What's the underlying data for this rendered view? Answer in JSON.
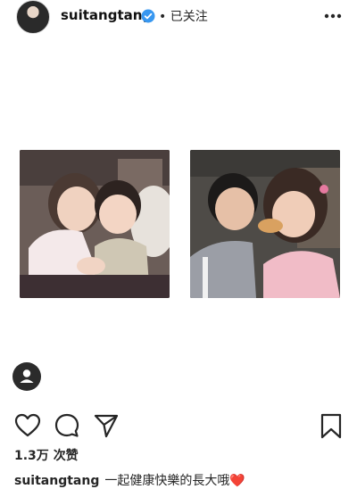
{
  "header": {
    "username": "suitangtang",
    "follow_status": "• 已关注",
    "more_icon": "more-dots-icon",
    "verified_icon": "verified-badge-icon"
  },
  "post": {
    "photos": [
      {
        "name": "left-photo"
      },
      {
        "name": "right-photo"
      }
    ],
    "tag_icon": "person-tag-icon"
  },
  "actions": {
    "like_icon": "heart-icon",
    "comment_icon": "comment-bubble-icon",
    "share_icon": "paper-plane-icon",
    "save_icon": "bookmark-icon"
  },
  "likes": {
    "count": "1.3万",
    "label": "次赞"
  },
  "caption": {
    "username": "suitangtang",
    "text": "一起健康快樂的長大哦",
    "emoji": "❤️"
  },
  "colors": {
    "verified_blue": "#3897f0",
    "text": "#262626",
    "heart_red": "#e0245e"
  }
}
